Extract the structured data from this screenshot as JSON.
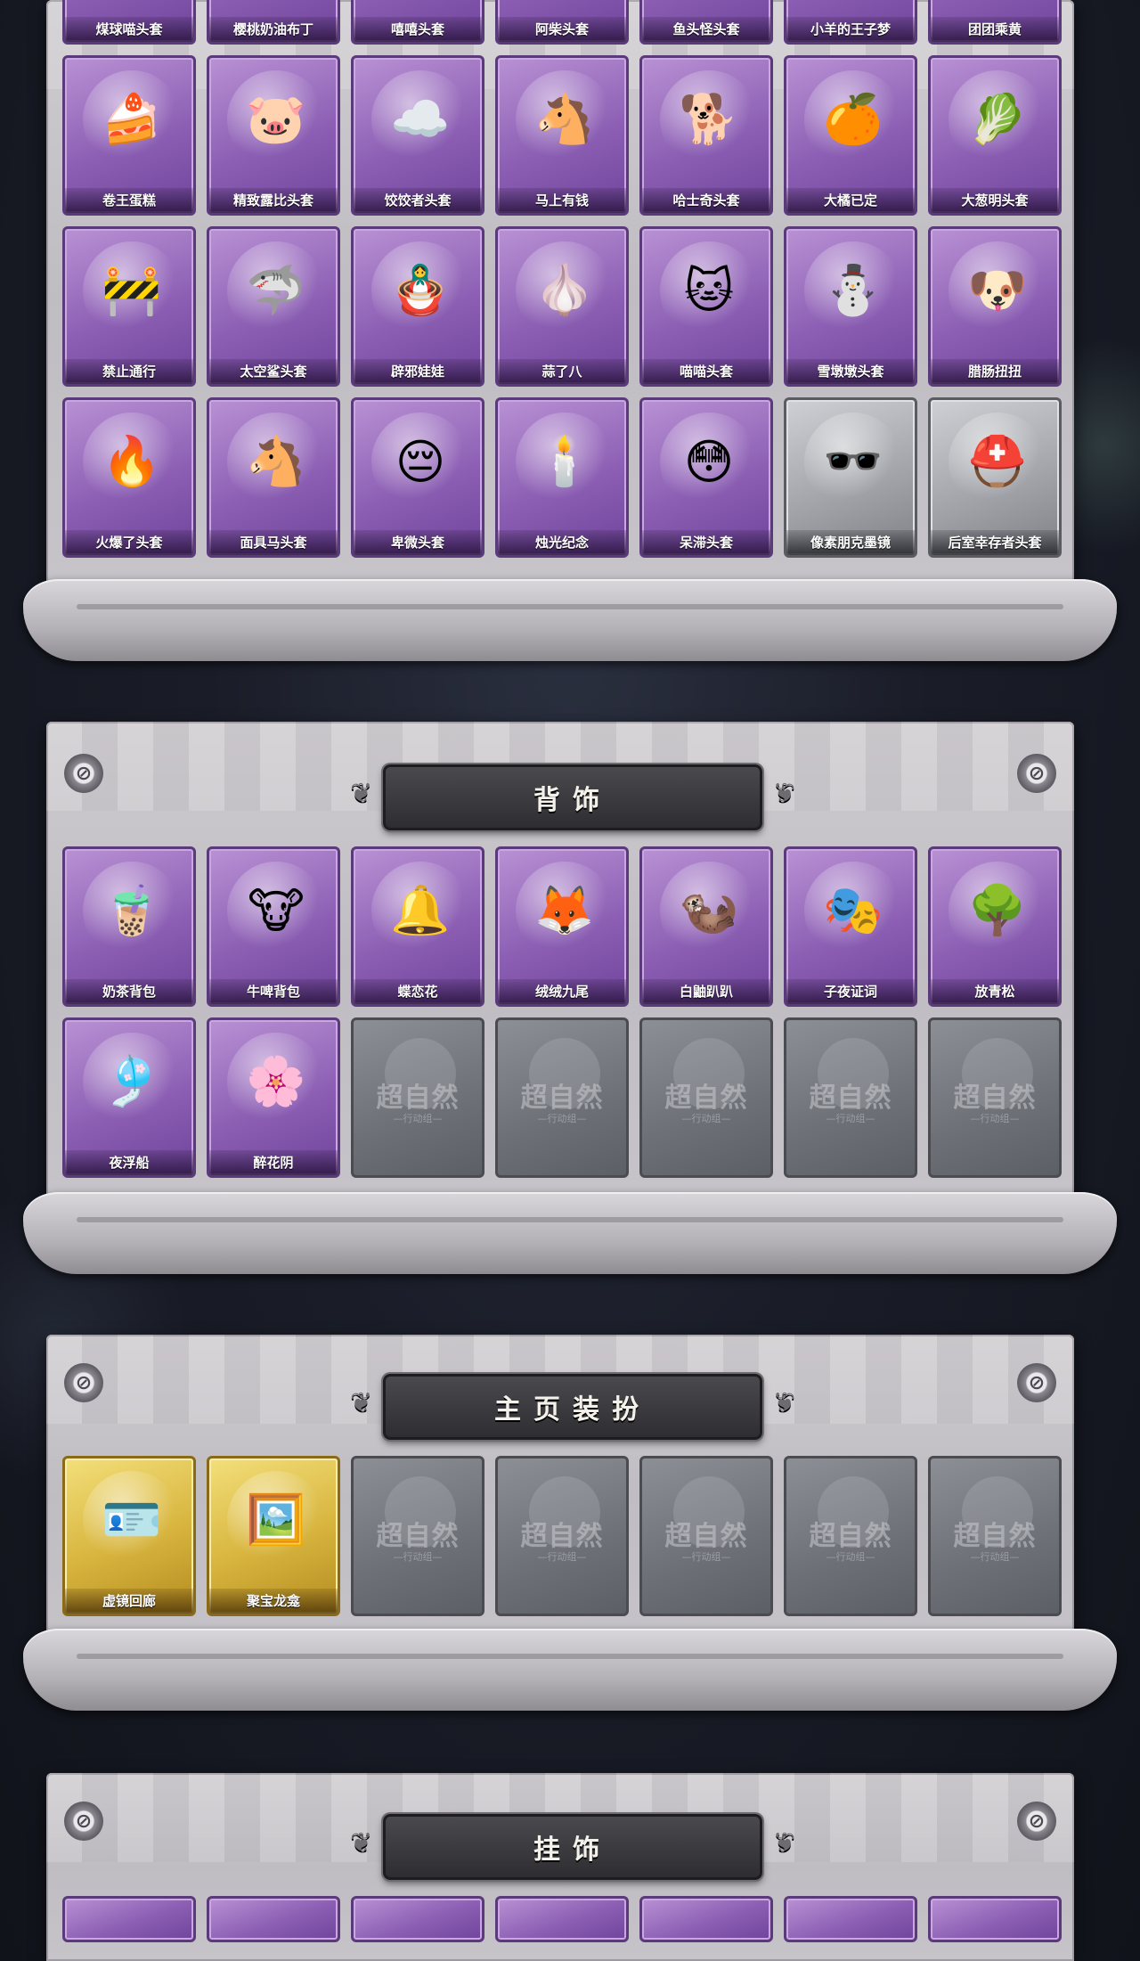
{
  "heads": {
    "row0": [
      "煤球喵头套",
      "樱桃奶油布丁",
      "嘻嘻头套",
      "阿柴头套",
      "鱼头怪头套",
      "小羊的王子梦",
      "团团乘黄"
    ],
    "rows": [
      [
        "卷王蛋糕",
        "精致露比头套",
        "饺饺者头套",
        "马上有钱",
        "哈士奇头套",
        "大橘已定",
        "大葱明头套"
      ],
      [
        "禁止通行",
        "太空鲨头套",
        "辟邪娃娃",
        "蒜了八",
        "喵喵头套",
        "雪墩墩头套",
        "腊肠扭扭"
      ],
      [
        "火爆了头套",
        "面具马头套",
        "卑微头套",
        "烛光纪念",
        "呆滞头套",
        "像素朋克墨镜",
        "后室幸存者头套"
      ]
    ],
    "row_icons": [
      [
        "🍰",
        "🐷",
        "☁️",
        "🐴",
        "🐕",
        "🍊",
        "🥬"
      ],
      [
        "🚧",
        "🦈",
        "🪆",
        "🧄",
        "🐱",
        "⛄",
        "🐶"
      ],
      [
        "🔥",
        "🐴",
        "😔",
        "🕯️",
        "😳",
        "🕶️",
        "⛑️"
      ]
    ]
  },
  "backpack": {
    "title": "背饰",
    "items": [
      "奶茶背包",
      "牛啤背包",
      "蝶恋花",
      "绒绒九尾",
      "白鼬趴趴",
      "子夜证词",
      "放青松",
      "夜浮船",
      "醉花阴"
    ],
    "icons": [
      "🧋",
      "🐮",
      "🔔",
      "🦊",
      "🦦",
      "🎭",
      "🌳",
      "🎐",
      "🌸"
    ]
  },
  "homepage": {
    "title": "主页装扮",
    "items": [
      "虚镜回廊",
      "聚宝龙龛"
    ],
    "icons": [
      "🪪",
      "🖼️"
    ]
  },
  "pendant": {
    "title": "挂饰"
  },
  "empty_slot": {
    "watermark": "超自然",
    "sub": "—行动组—"
  }
}
